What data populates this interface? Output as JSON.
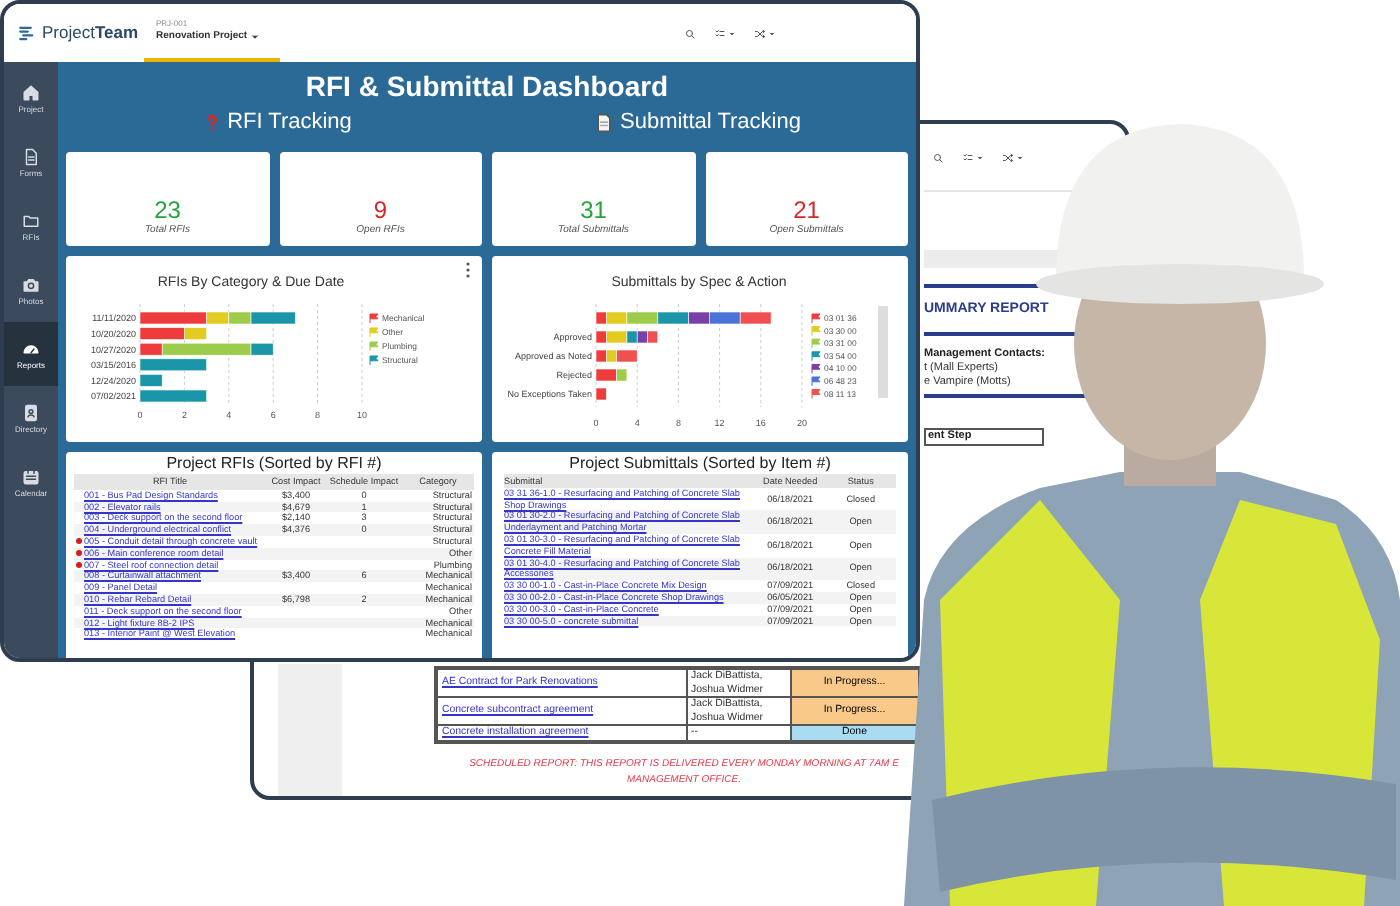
{
  "front_window": {
    "top_bar": {
      "logo": "Project**Team**",
      "project_label": "PRJ-001",
      "project_name": "Renovation Project"
    },
    "sidebar": {
      "items": [
        {
          "label": "Project",
          "selected": false
        },
        {
          "label": "Forms",
          "selected": false
        },
        {
          "label": "RFIs",
          "selected": false
        },
        {
          "label": "Photos",
          "selected": false
        },
        {
          "label": "Reports",
          "selected": true
        },
        {
          "label": "Directory",
          "selected": false
        },
        {
          "label": "Calendar",
          "selected": false
        }
      ]
    },
    "dashboard": {
      "title": "RFI & Submittal Dashboard",
      "sections": [
        {
          "label": "RFI Tracking",
          "kind": "question"
        },
        {
          "label": "Submittal Tracking",
          "kind": "document"
        }
      ],
      "kpis": [
        {
          "value": "23",
          "label": "Total RFIs",
          "color": "#22a43a"
        },
        {
          "value": "9",
          "label": "Open RFIs",
          "color": "#d62828"
        },
        {
          "value": "31",
          "label": "Total Submittals",
          "color": "#22a43a"
        },
        {
          "value": "21",
          "label": "Open Submittals",
          "color": "#d62828"
        }
      ],
      "charts": [
        {
          "chart_data": {
            "type": "bar",
            "orientation": "horizontal",
            "stacked": true,
            "grid": true,
            "legend": true,
            "title": "RFIs By Category & Due Date",
            "categories": [
              "11/11/2020",
              "10/20/2020",
              "10/27/2020",
              "03/15/2016",
              "12/24/2020",
              "07/02/2021"
            ],
            "xlim": [
              0,
              10
            ],
            "xticks": [
              0,
              2,
              4,
              6,
              8,
              10
            ],
            "series": [
              {
                "name": "Mechanical",
                "color": "#ee3b3b",
                "values": [
                  3,
                  2,
                  1,
                  0,
                  0,
                  0
                ]
              },
              {
                "name": "Other",
                "color": "#e3cc1f",
                "values": [
                  1,
                  1,
                  0,
                  0,
                  0,
                  0
                ]
              },
              {
                "name": "Plumbing",
                "color": "#9ccc4a",
                "values": [
                  1,
                  0,
                  4,
                  0,
                  0,
                  0
                ]
              },
              {
                "name": "Structural",
                "color": "#1b96a8",
                "values": [
                  2,
                  0,
                  1,
                  3,
                  1,
                  3
                ]
              }
            ]
          }
        },
        {
          "chart_data": {
            "type": "bar",
            "orientation": "horizontal",
            "stacked": true,
            "grid": true,
            "legend": true,
            "title": "Submittals by Spec & Action",
            "categories": [
              null,
              "Approved",
              "Approved as Noted",
              "Rejected",
              "No Exceptions Taken"
            ],
            "xlim": [
              0,
              20
            ],
            "xticks": [
              0,
              4,
              8,
              12,
              16,
              20
            ],
            "series": [
              {
                "name": "03 01 36",
                "color": "#ee3b3b",
                "values": [
                  1,
                  1,
                  1,
                  2,
                  1
                ]
              },
              {
                "name": "03 30 00",
                "color": "#e3cc1f",
                "values": [
                  2,
                  2,
                  1,
                  0,
                  0
                ]
              },
              {
                "name": "03 31 00",
                "color": "#9ccc4a",
                "values": [
                  3,
                  0,
                  0,
                  1,
                  0
                ]
              },
              {
                "name": "03 54 00",
                "color": "#1b96a8",
                "values": [
                  3,
                  1,
                  0,
                  0,
                  0
                ]
              },
              {
                "name": "04 10 00",
                "color": "#7b3fa8",
                "values": [
                  2,
                  1,
                  0,
                  0,
                  0
                ]
              },
              {
                "name": "06 48 23",
                "color": "#4a74d8",
                "values": [
                  3,
                  0,
                  0,
                  0,
                  0
                ]
              },
              {
                "name": "08 11 13",
                "color": "#f05050",
                "values": [
                  3,
                  1,
                  2,
                  0,
                  0
                ]
              }
            ]
          }
        }
      ],
      "rfi_table": {
        "title": "Project RFIs (Sorted by RFI #)",
        "columns": [
          "RFI Title",
          "Cost Impact",
          "Schedule Impact",
          "Category"
        ],
        "rows": [
          {
            "flagged": false,
            "cells": [
              "001 - Bus Pad Design Standards",
              "$3,400",
              "0",
              "Structural"
            ]
          },
          {
            "flagged": false,
            "cells": [
              "002 - Elevator rails",
              "$4,679",
              "1",
              "Structural"
            ]
          },
          {
            "flagged": false,
            "cells": [
              "003 - Deck support on the second floor",
              "$2,140",
              "3",
              "Structural"
            ]
          },
          {
            "flagged": false,
            "cells": [
              "004 - Underground electrical conflict",
              "$4,376",
              "0",
              "Structural"
            ]
          },
          {
            "flagged": true,
            "cells": [
              "005 - Conduit detail through concrete vault",
              "",
              "",
              "Structural"
            ]
          },
          {
            "flagged": true,
            "cells": [
              "006 - Main conference room detail",
              "",
              "",
              "Other"
            ]
          },
          {
            "flagged": true,
            "cells": [
              "007 - Steel roof connection detail",
              "",
              "",
              "Plumbing"
            ]
          },
          {
            "flagged": false,
            "cells": [
              "008 - Curtainwall attachment",
              "$3,400",
              "6",
              "Mechanical"
            ]
          },
          {
            "flagged": false,
            "cells": [
              "009 - Panel Detail",
              "",
              "",
              "Mechanical"
            ]
          },
          {
            "flagged": false,
            "cells": [
              "010 - Rebar Rebard Detail",
              "$6,798",
              "2",
              "Mechanical"
            ]
          },
          {
            "flagged": false,
            "cells": [
              "011 - Deck support on the second floor",
              "",
              "",
              "Other"
            ]
          },
          {
            "flagged": false,
            "cells": [
              "012 - Light fixture 8B-2 IPS",
              "",
              "",
              "Mechanical"
            ]
          },
          {
            "flagged": false,
            "cells": [
              "013 - Interior Paint @ West Elevation",
              "",
              "",
              "Mechanical"
            ]
          }
        ]
      },
      "submittal_table": {
        "title": "Project Submittals (Sorted by Item #)",
        "columns": [
          "Submittal",
          "Date Needed",
          "Status"
        ],
        "rows": [
          {
            "cells": [
              "03 31 36-1.0 - Resurfacing and Patching of Concrete Slab Shop Drawings",
              "06/18/2021",
              "Closed"
            ]
          },
          {
            "cells": [
              "03 01 30-2.0 - Resurfacing and Patching of Concrete Slab Underlayment and Patching Mortar",
              "06/18/2021",
              "Open"
            ]
          },
          {
            "cells": [
              "03 01 30-3.0 - Resurfacing and Patching of Concrete Slab Concrete Fill Material",
              "06/18/2021",
              "Open"
            ]
          },
          {
            "cells": [
              "03 01 30-4.0 - Resurfacing and Patching of Concrete Slab Accessories",
              "06/18/2021",
              "Open"
            ]
          },
          {
            "cells": [
              "03 30 00-1.0 - Cast-in-Place Concrete Mix Design",
              "07/09/2021",
              "Closed"
            ]
          },
          {
            "cells": [
              "03 30 00-2.0 - Cast-in-Place Concrete Shop Drawings",
              "06/05/2021",
              "Open"
            ]
          },
          {
            "cells": [
              "03 30 00-3.0 - Cast-in-Place Concrete",
              "07/09/2021",
              "Open"
            ]
          },
          {
            "cells": [
              "03 30 00-5.0 - concrete submittal",
              "07/09/2021",
              "Open"
            ]
          }
        ]
      }
    }
  },
  "back_window": {
    "report_title": "UMMARY REPORT",
    "contacts_heading": "Management Contacts:",
    "contacts": [
      "t (Mall Experts)",
      "e Vampire (Motts)"
    ],
    "step_header": "ent Step",
    "tasks": [
      {
        "title": "AE Contract for Park Renovations",
        "assignees": "Jack DiBattista, Joshua Widmer",
        "status": "In Progress...",
        "kind": "progress"
      },
      {
        "title": "Concrete subcontract agreement",
        "assignees": "Jack DiBattista, Joshua Widmer",
        "status": "In Progress...",
        "kind": "progress"
      },
      {
        "title": "Concrete installation agreement",
        "assignees": "--",
        "status": "Done",
        "kind": "done"
      }
    ],
    "footer_lines": [
      "SCHEDULED REPORT: THIS REPORT IS DELIVERED EVERY MONDAY MORNING AT 7AM E",
      "MANAGEMENT OFFICE."
    ]
  }
}
